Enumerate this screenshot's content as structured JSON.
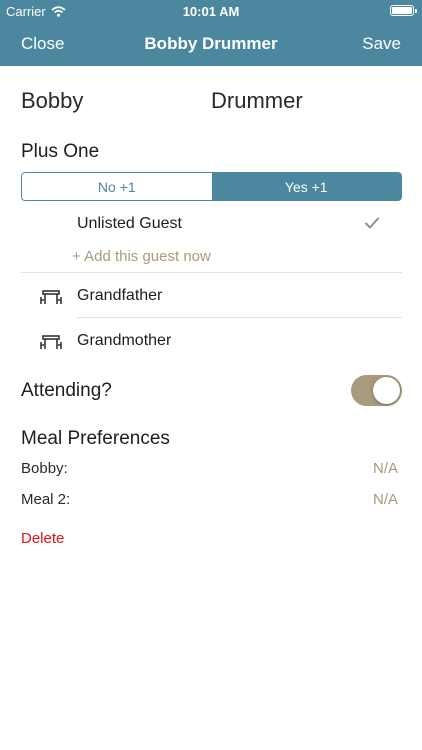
{
  "status_bar": {
    "carrier": "Carrier",
    "time": "10:01 AM"
  },
  "nav": {
    "close_label": "Close",
    "title": "Bobby Drummer",
    "save_label": "Save"
  },
  "name": {
    "first": "Bobby",
    "last": "Drummer"
  },
  "plus_one": {
    "title": "Plus One",
    "options": [
      "No +1",
      "Yes +1"
    ],
    "selected": "Yes +1",
    "guest_name": "Unlisted Guest",
    "add_guest_label": "+ Add this guest now"
  },
  "table_mates": [
    "Grandfather",
    "Grandmother"
  ],
  "attending": {
    "label": "Attending?",
    "on": true
  },
  "meal": {
    "title": "Meal Preferences",
    "rows": [
      {
        "label": "Bobby:",
        "value": "N/A"
      },
      {
        "label": "Meal 2:",
        "value": "N/A"
      }
    ]
  },
  "delete_label": "Delete",
  "colors": {
    "primary": "#4b879e",
    "accent": "#a89a7c",
    "danger": "#e0121a"
  }
}
